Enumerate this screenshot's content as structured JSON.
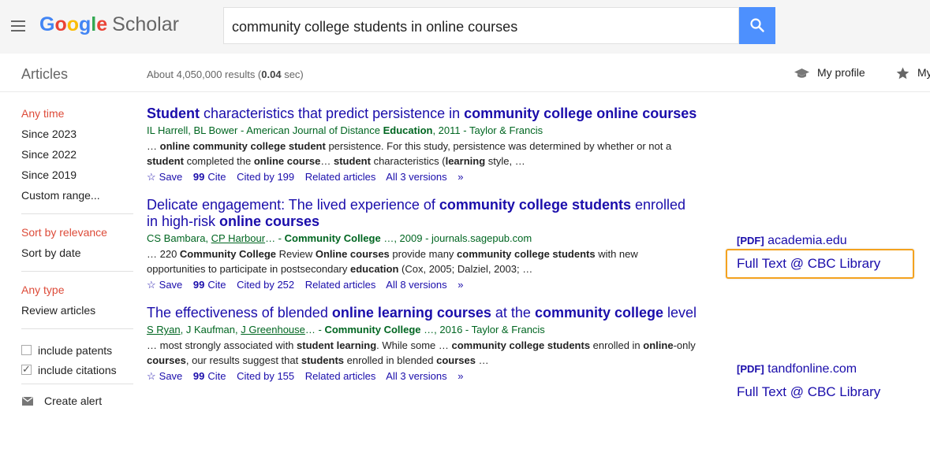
{
  "header": {
    "logo_google": "Google",
    "logo_scholar": "Scholar",
    "search_value": "community college students in online courses",
    "logo_colors": [
      "#4285f4",
      "#ea4335",
      "#fbbc05",
      "#4285f4",
      "#34a853",
      "#ea4335"
    ]
  },
  "subbar": {
    "articles": "Articles",
    "count_prefix": "About 4,050,000 results (",
    "count_time": "0.04",
    "count_suffix": " sec)",
    "my_profile": "My profile",
    "my_library": "My library"
  },
  "sidebar": {
    "time": [
      "Any time",
      "Since 2023",
      "Since 2022",
      "Since 2019",
      "Custom range..."
    ],
    "sort": [
      "Sort by relevance",
      "Sort by date"
    ],
    "type": [
      "Any type",
      "Review articles"
    ],
    "include_patents": "include patents",
    "include_citations": "include citations",
    "create_alert": "Create alert"
  },
  "results": [
    {
      "save": "Save",
      "cite": "Cite",
      "cited_by": "Cited by 199",
      "related": "Related articles",
      "versions": "All 3 versions"
    },
    {
      "save": "Save",
      "cite": "Cite",
      "cited_by": "Cited by 252",
      "related": "Related articles",
      "versions": "All 8 versions",
      "pdf_tag": "[PDF]",
      "pdf_source": "academia.edu",
      "full_text": "Full Text @ CBC Library"
    },
    {
      "save": "Save",
      "cite": "Cite",
      "cited_by": "Cited by 155",
      "related": "Related articles",
      "versions": "All 3 versions",
      "pdf_tag": "[PDF]",
      "pdf_source": "tandfonline.com",
      "full_text": "Full Text @ CBC Library"
    }
  ],
  "colors": {
    "link": "#1a0dab",
    "meta_green": "#006621",
    "selected_red": "#dd4b39",
    "search_blue": "#4d90fe",
    "highlight_orange": "#f4a21f"
  }
}
